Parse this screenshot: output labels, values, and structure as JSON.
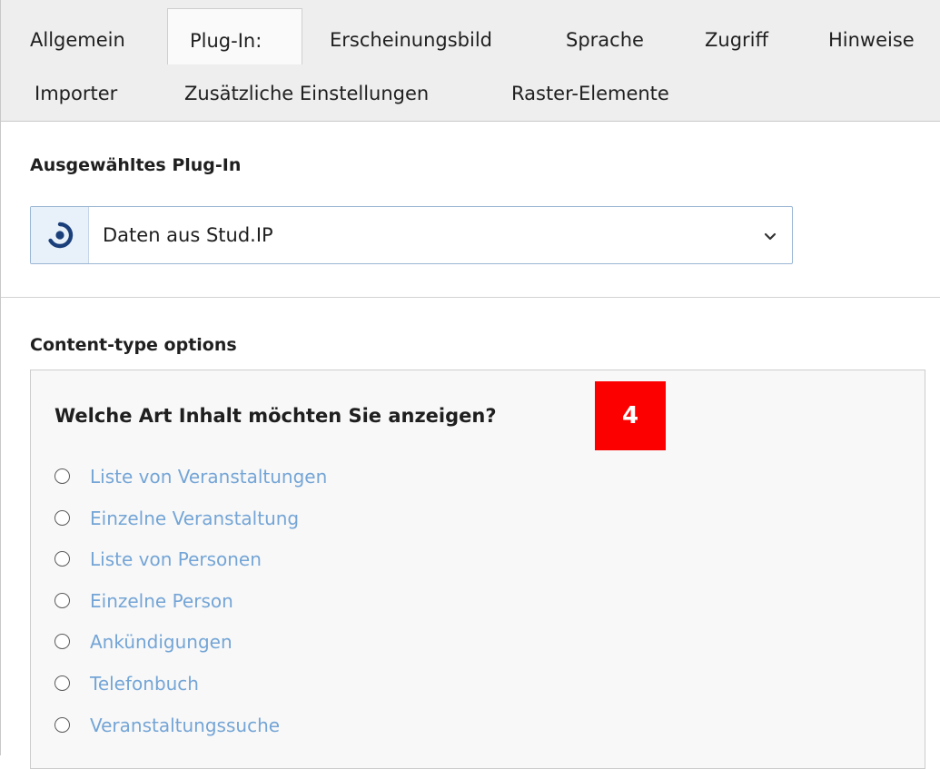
{
  "tabs": {
    "row1": [
      "Allgemein",
      "Plug-In:",
      "Erscheinungsbild",
      "Sprache",
      "Zugriff",
      "Hinweise"
    ],
    "row2": [
      "Importer",
      "Zusätzliche Einstellungen",
      "Raster-Elemente"
    ],
    "active": "Plug-In:"
  },
  "plugin_section": {
    "title": "Ausgewähltes Plug-In",
    "select_value": "Daten aus Stud.IP",
    "select_icon": "studip-logo-icon"
  },
  "content_type": {
    "title": "Content-type options",
    "question": "Welche Art Inhalt möchten Sie anzeigen?",
    "badge": "4",
    "options": [
      "Liste von Veranstaltungen",
      "Einzelne Veranstaltung",
      "Liste von Personen",
      "Einzelne Person",
      "Ankündigungen",
      "Telefonbuch",
      "Veranstaltungssuche"
    ]
  },
  "colors": {
    "badge": "#fc0000",
    "link": "#74a5d6",
    "icon": "#1a3f7a"
  }
}
